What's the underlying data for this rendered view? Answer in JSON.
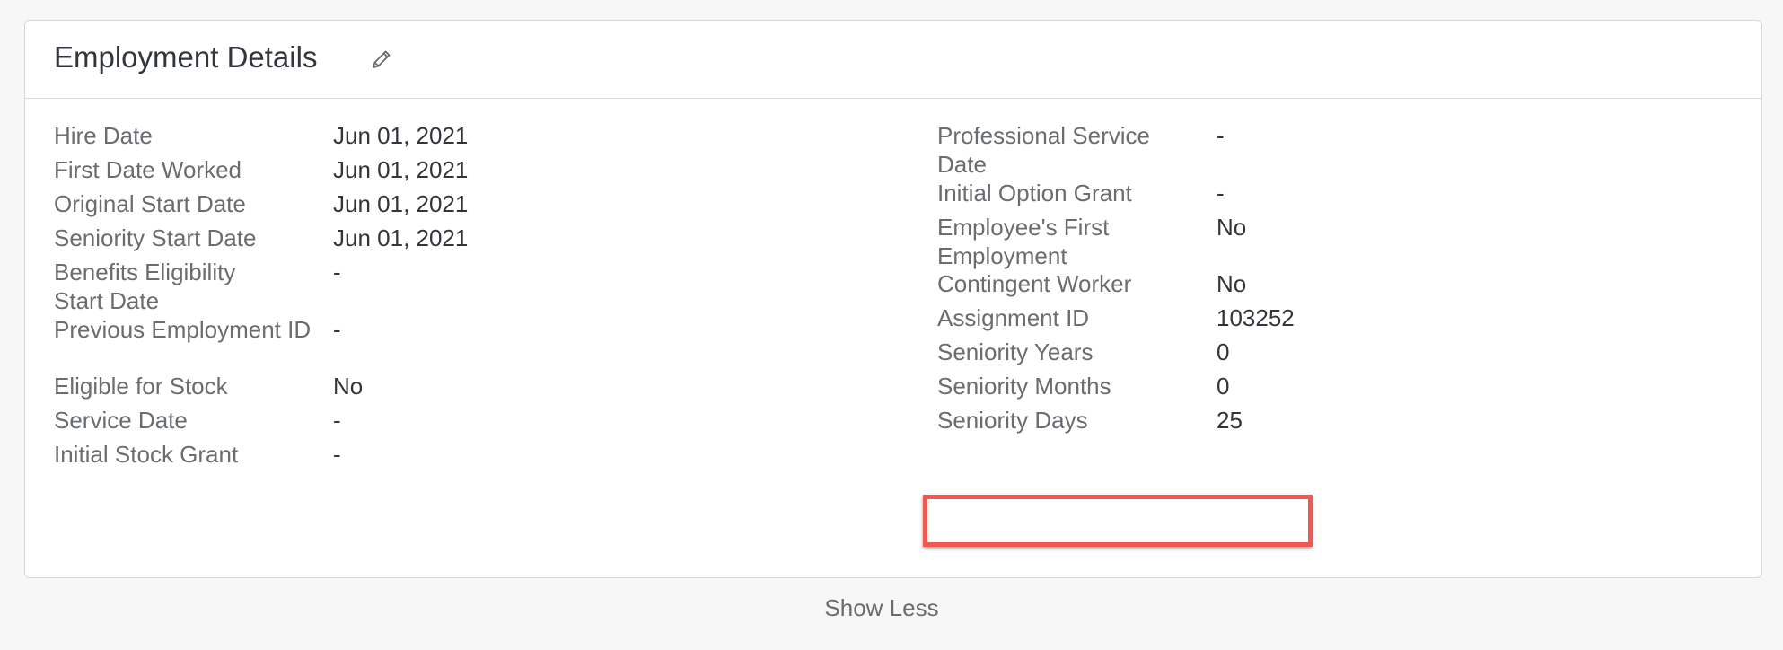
{
  "card": {
    "title": "Employment Details",
    "edit_icon": "pencil-icon"
  },
  "left_fields": [
    {
      "label": "Hire Date",
      "value": "Jun 01, 2021"
    },
    {
      "label": "First Date Worked",
      "value": "Jun 01, 2021"
    },
    {
      "label": "Original Start Date",
      "value": "Jun 01, 2021"
    },
    {
      "label": "Seniority Start Date",
      "value": "Jun 01, 2021"
    },
    {
      "label": "Benefits Eligibility Start Date",
      "value": "-"
    },
    {
      "label": "Previous Employment ID",
      "value": "-"
    },
    {
      "label": "Eligible for Stock",
      "value": "No"
    },
    {
      "label": "Service Date",
      "value": "-"
    },
    {
      "label": "Initial Stock Grant",
      "value": "-"
    }
  ],
  "right_fields": [
    {
      "label": "Professional Service Date",
      "value": "-"
    },
    {
      "label": "Initial Option Grant",
      "value": "-"
    },
    {
      "label": "Employee's First Employment",
      "value": "No"
    },
    {
      "label": "Contingent Worker",
      "value": "No"
    },
    {
      "label": "Assignment ID",
      "value": "103252"
    },
    {
      "label": "Seniority Years",
      "value": "0"
    },
    {
      "label": "Seniority Months",
      "value": "0"
    },
    {
      "label": "Seniority Days",
      "value": "25"
    }
  ],
  "footer": {
    "show_less_label": "Show Less"
  },
  "colors": {
    "highlight": "#ee5a4f",
    "label": "#6a6d70",
    "value": "#32363a"
  }
}
